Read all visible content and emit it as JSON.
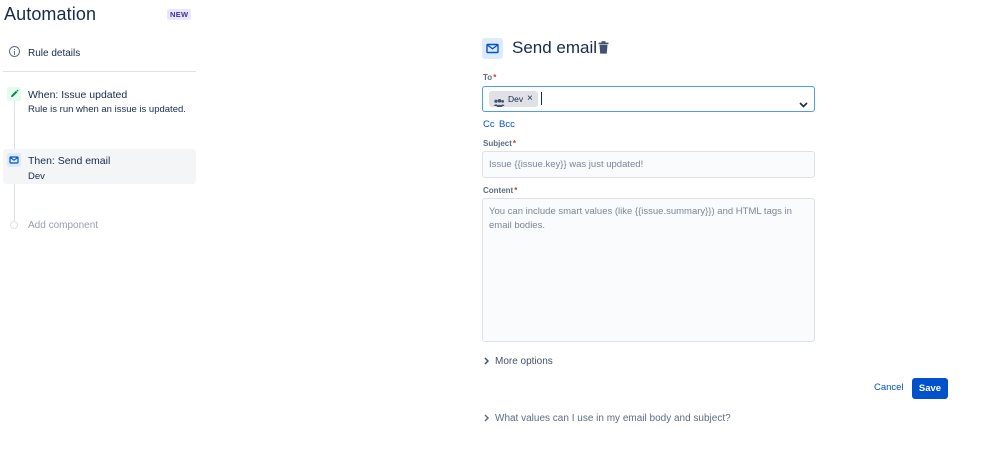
{
  "app": {
    "title": "Automation",
    "badge": "NEW"
  },
  "sidebar": {
    "rule_details": "Rule details",
    "trigger": {
      "title": "When: Issue updated",
      "subtitle": "Rule is run when an issue is updated.",
      "accent": "#36b37e"
    },
    "action": {
      "title": "Then: Send email",
      "subtitle": "Dev",
      "accent": "#0052cc"
    },
    "add_component": "Add component"
  },
  "form": {
    "title": "Send email",
    "icons": {
      "header": "mail-icon",
      "delete": "trash-icon"
    },
    "to": {
      "label": "To",
      "required_mark": "*",
      "chips": [
        {
          "label": "Dev",
          "icon": "group-icon"
        }
      ]
    },
    "cc_label": "Cc",
    "bcc_label": "Bcc",
    "subject": {
      "label": "Subject",
      "required_mark": "*",
      "placeholder": "Issue {{issue.key}} was just updated!"
    },
    "content": {
      "label": "Content",
      "required_mark": "*",
      "placeholder": "You can include smart values (like {{issue.summary}}) and HTML tags in email bodies."
    },
    "more_options": "More options",
    "cancel_label": "Cancel",
    "save_label": "Save",
    "help_text": "What values can I use in my email body and subject?"
  },
  "colors": {
    "primary": "#0052cc",
    "focus_border": "#4c9aff",
    "text": "#172b4d",
    "required": "#de350b"
  }
}
